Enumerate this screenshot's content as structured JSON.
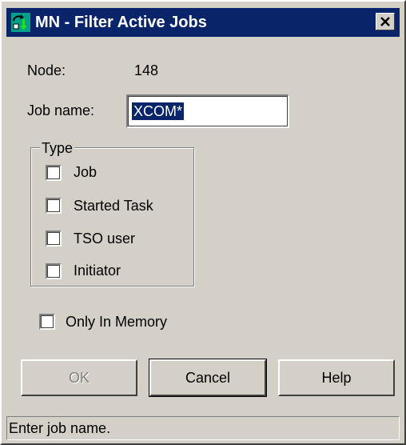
{
  "window": {
    "title": "MN - Filter Active Jobs",
    "icon": "app-icon",
    "close_icon": "close-icon"
  },
  "node": {
    "label": "Node:",
    "value": "148"
  },
  "job_name": {
    "label": "Job name:",
    "value": "XCOM*"
  },
  "type_group": {
    "legend": "Type",
    "options": [
      {
        "label": "Job",
        "checked": false
      },
      {
        "label": "Started Task",
        "checked": false
      },
      {
        "label": "TSO user",
        "checked": false
      },
      {
        "label": "Initiator",
        "checked": false
      }
    ]
  },
  "only_in_memory": {
    "label": "Only In Memory",
    "checked": false
  },
  "buttons": {
    "ok": "OK",
    "cancel": "Cancel",
    "help": "Help"
  },
  "status": {
    "text": "Enter job name."
  },
  "colors": {
    "titlebar": "#0a246a",
    "face": "#d4d0c8",
    "selection": "#0a246a"
  }
}
